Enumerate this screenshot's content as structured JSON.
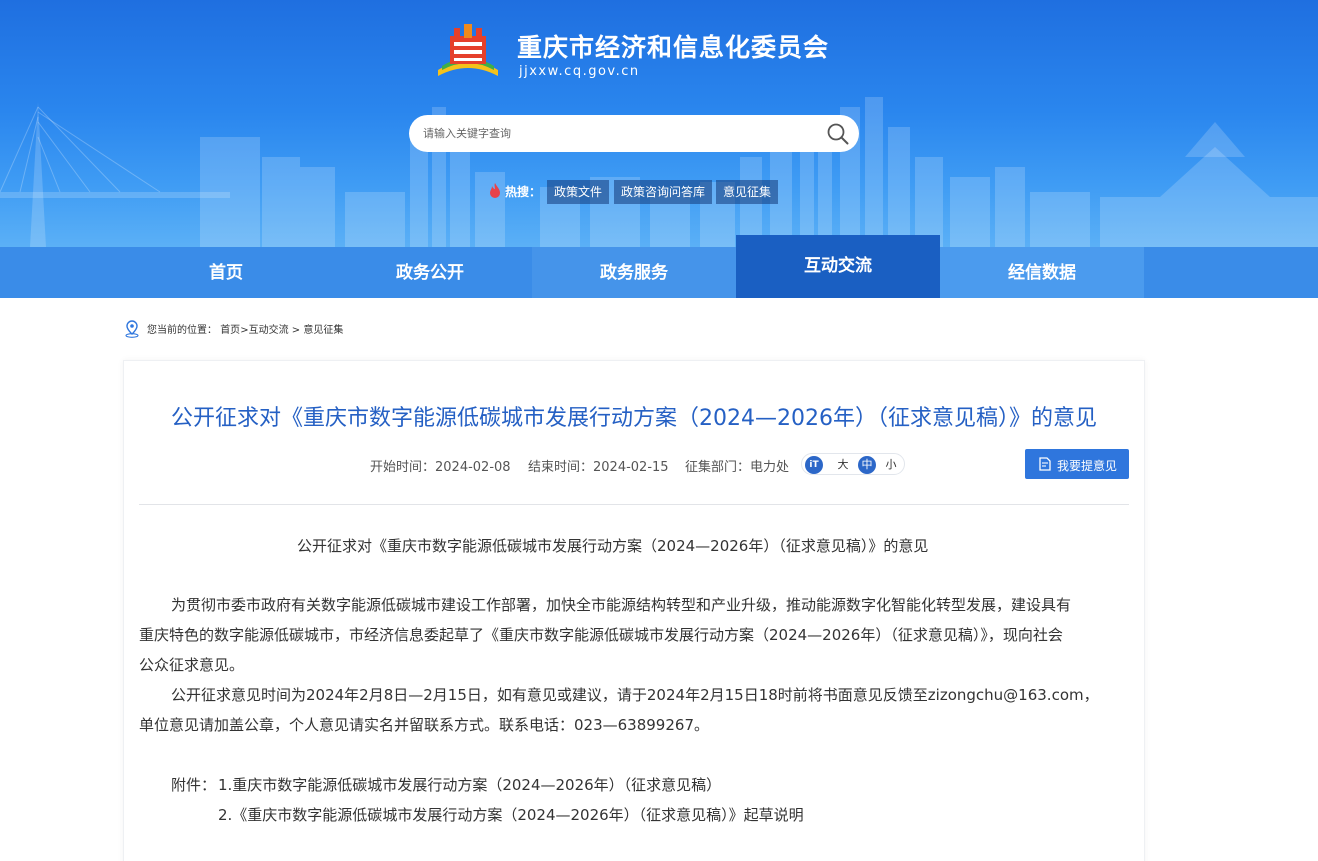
{
  "header": {
    "site_name": "重庆市经济和信息化委员会",
    "domain": "jjxxw.cq.gov.cn",
    "search_placeholder": "请输入关键字查询",
    "hot_label": "热搜：",
    "hot_tags": [
      "政策文件",
      "政策咨询问答库",
      "意见征集"
    ]
  },
  "nav": {
    "items": [
      "首页",
      "政务公开",
      "政务服务",
      "互动交流",
      "经信数据"
    ],
    "active": "互动交流"
  },
  "breadcrumb": {
    "prefix": "您当前的位置：",
    "items": [
      "首页",
      "互动交流",
      "意见征集"
    ],
    "separator": ">"
  },
  "article": {
    "title": "公开征求对《重庆市数字能源低碳城市发展行动方案（2024—2026年）（征求意见稿）》的意见",
    "meta": {
      "start": "开始时间：2024-02-08",
      "end": "结束时间：2024-02-15",
      "dept": "征集部门：电力处"
    },
    "font_size": {
      "icon_text": "iT",
      "options": [
        "大",
        "中",
        "小"
      ],
      "selected": "中"
    },
    "opinion_button": "我要提意见",
    "body_title": "公开征求对《重庆市数字能源低碳城市发展行动方案（2024—2026年）（征求意见稿）》的意见",
    "para1_line1": "为贯彻市委市政府有关数字能源低碳城市建设工作部署，加快全市能源结构转型和产业升级，推动能源数字化智能化转型发展，建设具有",
    "para1_line2": "重庆特色的数字能源低碳城市，市经济信息委起草了《重庆市数字能源低碳城市发展行动方案（2024—2026年）（征求意见稿）》，现向社会",
    "para1_line3": "公众征求意见。",
    "para2_line1": "公开征求意见时间为2024年2月8日—2月15日，如有意见或建议，请于2024年2月15日18时前将书面意见反馈至zizongchu@163.com，",
    "para2_line2": "单位意见请加盖公章，个人意见请实名并留联系方式。联系电话：023—63899267。",
    "attachment_label": "附件：",
    "attachments": [
      "1.重庆市数字能源低碳城市发展行动方案（2024—2026年）（征求意见稿）",
      "2.《重庆市数字能源低碳城市发展行动方案（2024—2026年）（征求意见稿）》起草说明"
    ]
  },
  "colors": {
    "banner": "#2a86ee",
    "nav": "#3a8ce8",
    "nav_active": "#1a5fc2",
    "title": "#2560c4",
    "button": "#2f76dd"
  }
}
